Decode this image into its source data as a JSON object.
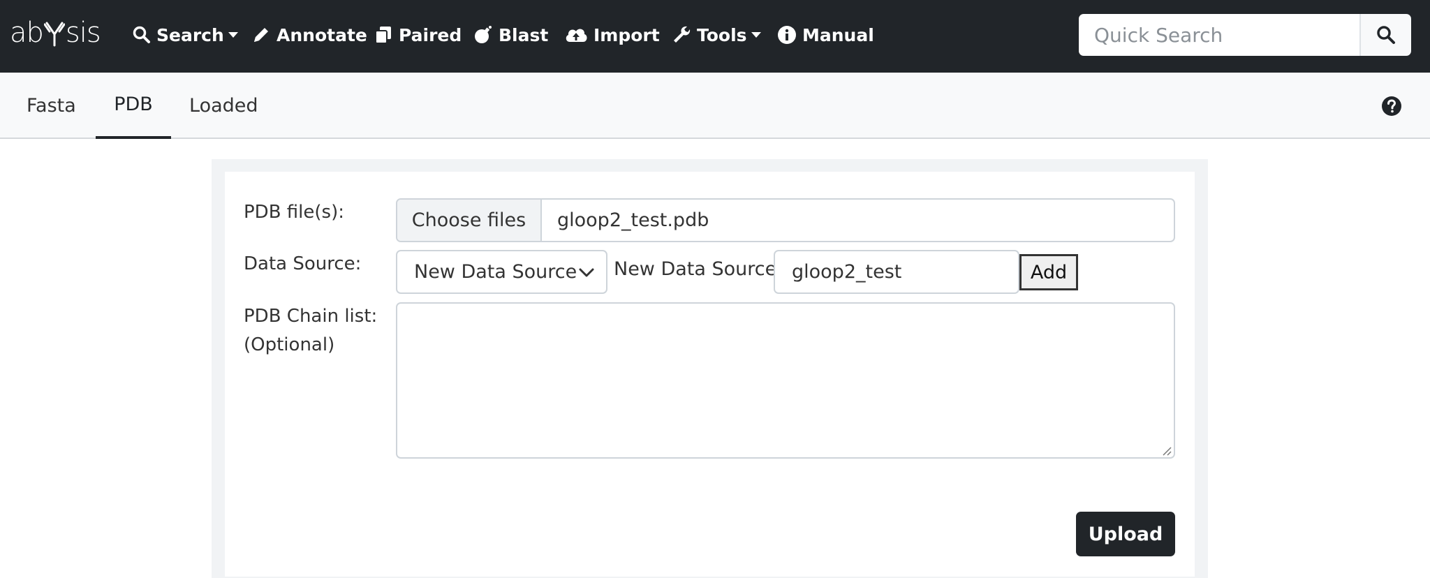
{
  "navbar": {
    "logo": {
      "pre": "ab",
      "post": "sis"
    },
    "items": [
      {
        "label": "Search",
        "icon": "search-icon",
        "dropdown": true
      },
      {
        "label": "Annotate",
        "icon": "pencil-icon",
        "dropdown": false
      },
      {
        "label": "Paired",
        "icon": "copy-icon",
        "dropdown": false
      },
      {
        "label": "Blast",
        "icon": "bomb-icon",
        "dropdown": false
      },
      {
        "label": "Import",
        "icon": "cloud-upload-icon",
        "dropdown": false
      },
      {
        "label": "Tools",
        "icon": "wrench-icon",
        "dropdown": true
      },
      {
        "label": "Manual",
        "icon": "info-icon",
        "dropdown": false
      }
    ],
    "quick_search": {
      "placeholder": "Quick Search",
      "button_icon": "search-icon"
    }
  },
  "tabs": [
    {
      "label": "Fasta",
      "active": false
    },
    {
      "label": "PDB",
      "active": true
    },
    {
      "label": "Loaded",
      "active": false
    }
  ],
  "help_icon": "question-circle-icon",
  "form": {
    "pdb_files_label": "PDB file(s):",
    "choose_files_label": "Choose files",
    "file_name": "gloop2_test.pdb",
    "data_source_label": "Data Source:",
    "data_source_selected": "New Data Source",
    "new_data_source_label": "New Data Source:",
    "new_data_source_value": "gloop2_test",
    "add_label": "Add",
    "chain_list_label_line1": "PDB Chain list:",
    "chain_list_label_line2": "(Optional)",
    "chain_list_value": "",
    "upload_label": "Upload"
  },
  "colors": {
    "navbar_bg": "#212529",
    "tabbar_bg": "#f8f9fa",
    "button_dark": "#212529",
    "border": "#ced4da"
  }
}
